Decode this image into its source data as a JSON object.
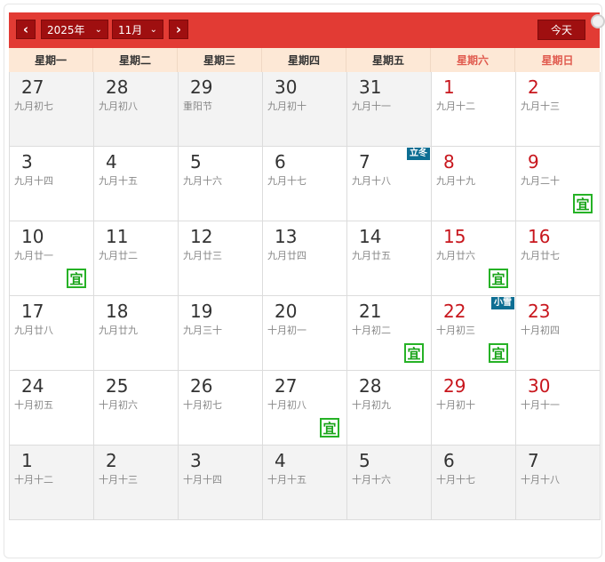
{
  "header": {
    "prev_icon": "chevron-left",
    "next_icon": "chevron-right",
    "year": "2025年",
    "month": "11月",
    "today_label": "今天"
  },
  "weekdays": [
    "星期一",
    "星期二",
    "星期三",
    "星期四",
    "星期五",
    "星期六",
    "星期日"
  ],
  "weeks": [
    [
      {
        "day": "27",
        "lunar": "九月初七",
        "other": true
      },
      {
        "day": "28",
        "lunar": "九月初八",
        "other": true
      },
      {
        "day": "29",
        "lunar": "重阳节",
        "other": true
      },
      {
        "day": "30",
        "lunar": "九月初十",
        "other": true
      },
      {
        "day": "31",
        "lunar": "九月十一",
        "other": true
      },
      {
        "day": "1",
        "lunar": "九月十二",
        "red": true
      },
      {
        "day": "2",
        "lunar": "九月十三",
        "red": true
      }
    ],
    [
      {
        "day": "3",
        "lunar": "九月十四"
      },
      {
        "day": "4",
        "lunar": "九月十五"
      },
      {
        "day": "5",
        "lunar": "九月十六"
      },
      {
        "day": "6",
        "lunar": "九月十七"
      },
      {
        "day": "7",
        "lunar": "九月十八",
        "term": "立冬"
      },
      {
        "day": "8",
        "lunar": "九月十九",
        "red": true
      },
      {
        "day": "9",
        "lunar": "九月二十",
        "red": true,
        "yi": "宜"
      }
    ],
    [
      {
        "day": "10",
        "lunar": "九月廿一",
        "yi": "宜"
      },
      {
        "day": "11",
        "lunar": "九月廿二"
      },
      {
        "day": "12",
        "lunar": "九月廿三"
      },
      {
        "day": "13",
        "lunar": "九月廿四"
      },
      {
        "day": "14",
        "lunar": "九月廿五"
      },
      {
        "day": "15",
        "lunar": "九月廿六",
        "red": true,
        "yi": "宜"
      },
      {
        "day": "16",
        "lunar": "九月廿七",
        "red": true
      }
    ],
    [
      {
        "day": "17",
        "lunar": "九月廿八"
      },
      {
        "day": "18",
        "lunar": "九月廿九"
      },
      {
        "day": "19",
        "lunar": "九月三十"
      },
      {
        "day": "20",
        "lunar": "十月初一"
      },
      {
        "day": "21",
        "lunar": "十月初二",
        "yi": "宜"
      },
      {
        "day": "22",
        "lunar": "十月初三",
        "red": true,
        "yi": "宜",
        "term": "小雪"
      },
      {
        "day": "23",
        "lunar": "十月初四",
        "red": true
      }
    ],
    [
      {
        "day": "24",
        "lunar": "十月初五"
      },
      {
        "day": "25",
        "lunar": "十月初六"
      },
      {
        "day": "26",
        "lunar": "十月初七"
      },
      {
        "day": "27",
        "lunar": "十月初八",
        "yi": "宜"
      },
      {
        "day": "28",
        "lunar": "十月初九"
      },
      {
        "day": "29",
        "lunar": "十月初十",
        "red": true
      },
      {
        "day": "30",
        "lunar": "十月十一",
        "red": true
      }
    ],
    [
      {
        "day": "1",
        "lunar": "十月十二",
        "other": true
      },
      {
        "day": "2",
        "lunar": "十月十三",
        "other": true
      },
      {
        "day": "3",
        "lunar": "十月十四",
        "other": true
      },
      {
        "day": "4",
        "lunar": "十月十五",
        "other": true
      },
      {
        "day": "5",
        "lunar": "十月十六",
        "other": true
      },
      {
        "day": "6",
        "lunar": "十月十七",
        "other": true
      },
      {
        "day": "7",
        "lunar": "十月十八",
        "other": true
      }
    ]
  ]
}
